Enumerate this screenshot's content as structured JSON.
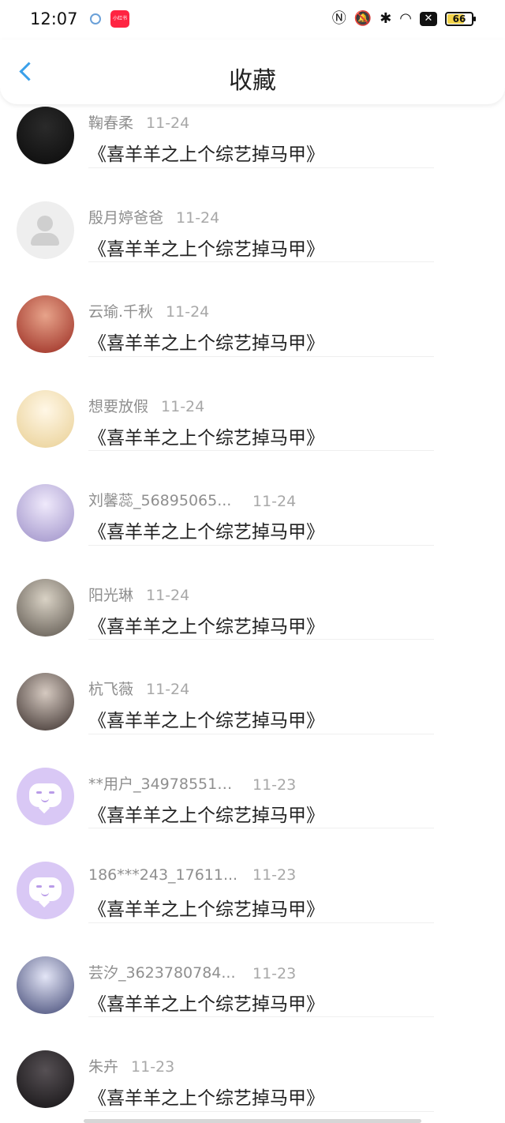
{
  "status": {
    "time": "12:07",
    "app_badge": "小红书",
    "battery": "66",
    "icons": [
      "nfc-icon",
      "bell-off-icon",
      "bluetooth-icon",
      "wifi-icon",
      "sim-off-icon",
      "battery-icon"
    ]
  },
  "header": {
    "title": "收藏",
    "back_icon": "chevron-left-icon"
  },
  "items": [
    {
      "name": "鞠春柔",
      "date": "11-24",
      "content": "《喜羊羊之上个综艺掉马甲》",
      "avatar": "photo",
      "c1": "#2a2a2a",
      "c2": "#0b0b0b"
    },
    {
      "name": "殷月婷爸爸",
      "date": "11-24",
      "content": "《喜羊羊之上个综艺掉马甲》",
      "avatar": "default"
    },
    {
      "name": "云瑜.千秋",
      "date": "11-24",
      "content": "《喜羊羊之上个综艺掉马甲》",
      "avatar": "photo",
      "c1": "#e7a38a",
      "c2": "#9a2a20"
    },
    {
      "name": "想要放假",
      "date": "11-24",
      "content": "《喜羊羊之上个综艺掉马甲》",
      "avatar": "photo",
      "c1": "#fff7e6",
      "c2": "#e9cf93"
    },
    {
      "name": "刘馨蕊_56895065...",
      "date": "11-24",
      "content": "《喜羊羊之上个综艺掉马甲》",
      "avatar": "photo",
      "c1": "#efe9fb",
      "c2": "#9d90c8"
    },
    {
      "name": "阳光琳",
      "date": "11-24",
      "content": "《喜羊羊之上个综艺掉马甲》",
      "avatar": "photo",
      "c1": "#d9d2c5",
      "c2": "#5b544c"
    },
    {
      "name": "杭飞薇",
      "date": "11-24",
      "content": "《喜羊羊之上个综艺掉马甲》",
      "avatar": "photo",
      "c1": "#d5c9c0",
      "c2": "#3a2f2c"
    },
    {
      "name": "**用户_349785511...",
      "date": "11-23",
      "content": "《喜羊羊之上个综艺掉马甲》",
      "avatar": "purple"
    },
    {
      "name": "186***243_17611...",
      "date": "11-23",
      "content": "《喜羊羊之上个综艺掉马甲》",
      "avatar": "purple"
    },
    {
      "name": "芸汐_3623780784...",
      "date": "11-23",
      "content": "《喜羊羊之上个综艺掉马甲》",
      "avatar": "photo",
      "c1": "#e3e5f6",
      "c2": "#414875"
    },
    {
      "name": "朱卉",
      "date": "11-23",
      "content": "《喜羊羊之上个综艺掉马甲》",
      "avatar": "photo",
      "c1": "#565054",
      "c2": "#141214"
    }
  ]
}
